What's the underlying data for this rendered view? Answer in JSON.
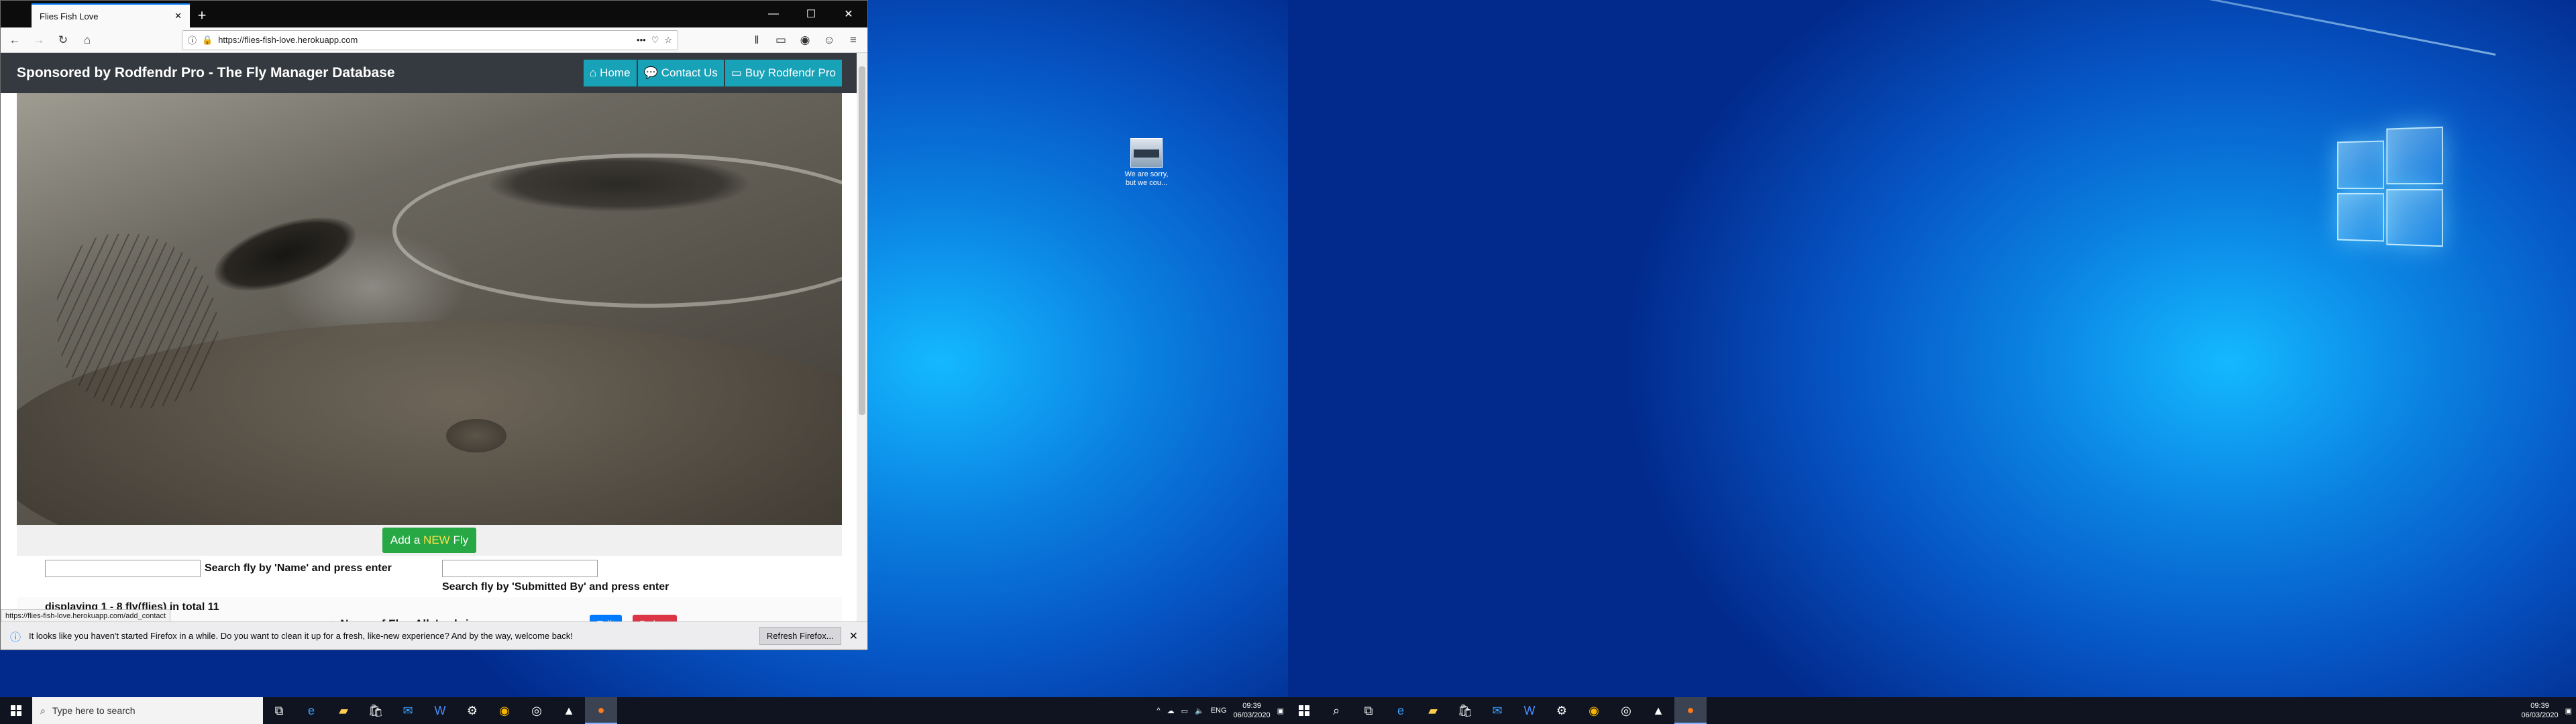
{
  "browser": {
    "tab_title": "Flies Fish Love",
    "tab_close": "✕",
    "new_tab": "+",
    "win_minimize": "—",
    "win_maximize": "☐",
    "win_close": "✕",
    "url": "https://flies-fish-love.herokuapp.com",
    "status_url": "https://flies-fish-love.herokuapp.com/add_contact",
    "notification": "It looks like you haven't started Firefox in a while. Do you want to clean it up for a fresh, like-new experience? And by the way, welcome back!",
    "refresh_button": "Refresh Firefox..."
  },
  "site": {
    "brand": "Sponsored by Rodfendr Pro - The Fly Manager Database",
    "nav": {
      "home": "Home",
      "contact": "Contact Us",
      "buy": "Buy Rodfendr Pro"
    },
    "add_button_prefix": "Add a ",
    "add_button_new": "NEW",
    "add_button_suffix": " Fly",
    "search_name_label": "Search fly by 'Name' and press enter",
    "search_submitted_label": "Search fly by 'Submitted By' and press enter",
    "displaying": "displaying 1 - 8 fly(flies) in total 11",
    "fly_name": "Name of Fly : Ally's shrimp",
    "edit": "Edit",
    "delete": "Delete"
  },
  "desktop": {
    "icon_label": "We are sorry, but we cou..."
  },
  "taskbar": {
    "search_placeholder": "Type here to search",
    "language": "ENG",
    "time": "09:39",
    "date": "06/03/2020"
  },
  "colors": {
    "nav_bg": "#343a40",
    "nav_btn": "#17a2b8",
    "add_btn": "#28a745",
    "edit_btn": "#007bff",
    "delete_btn": "#dc3545"
  }
}
